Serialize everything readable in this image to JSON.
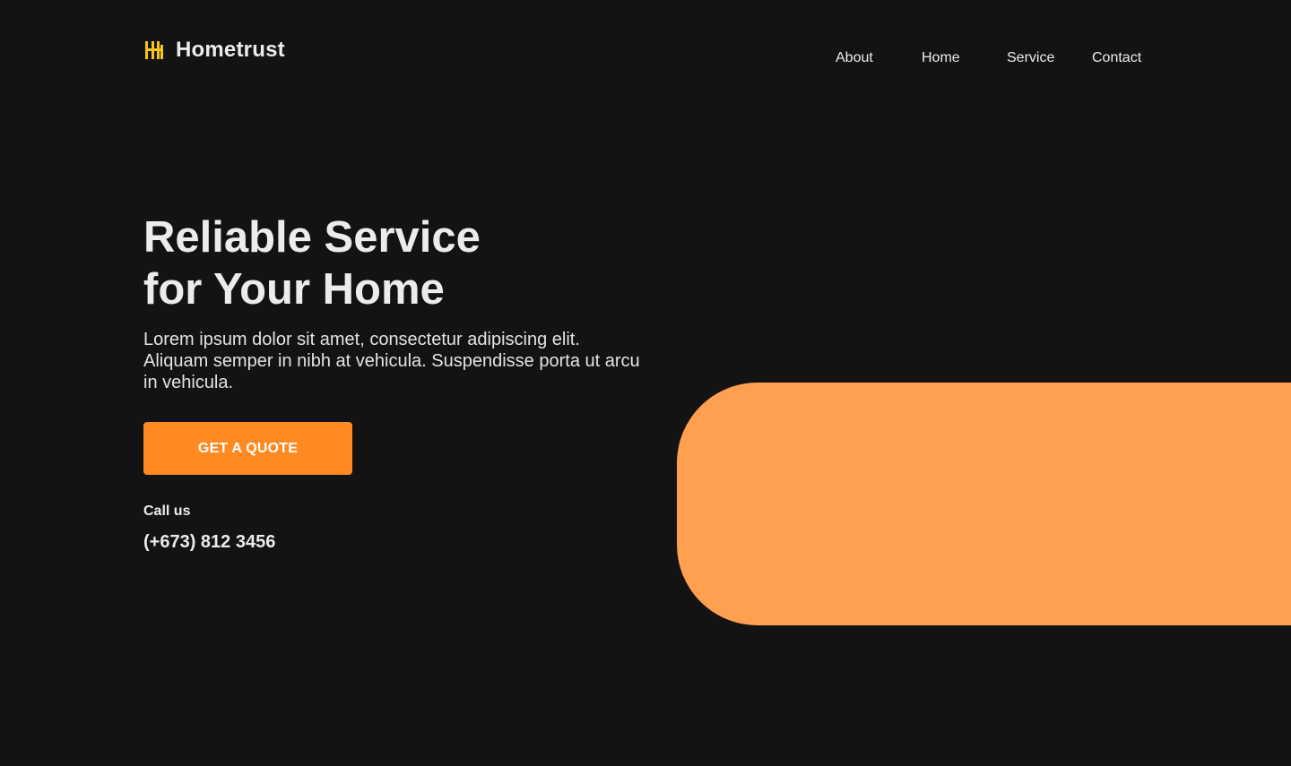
{
  "brand": {
    "name": "Hometrust",
    "icon": "hometrust-logo-icon",
    "icon_color": "#F5C518"
  },
  "nav": {
    "items": [
      {
        "label": "About"
      },
      {
        "label": "Home"
      },
      {
        "label": "Service"
      },
      {
        "label": "Contact"
      }
    ]
  },
  "hero": {
    "title_line1": "Reliable Service",
    "title_line2": "for Your Home",
    "description": "Lorem ipsum dolor sit amet, consectetur adipiscing elit. Aliquam semper in nibh at vehicula. Suspendisse porta ut arcu in vehicula.",
    "cta_label": "GET A QUOTE",
    "call_label": "Call us",
    "phone": "(+673) 812 3456"
  },
  "colors": {
    "background": "#131313",
    "text": "#ECECEC",
    "accent": "#FF8A22",
    "shape": "#FFA051"
  }
}
